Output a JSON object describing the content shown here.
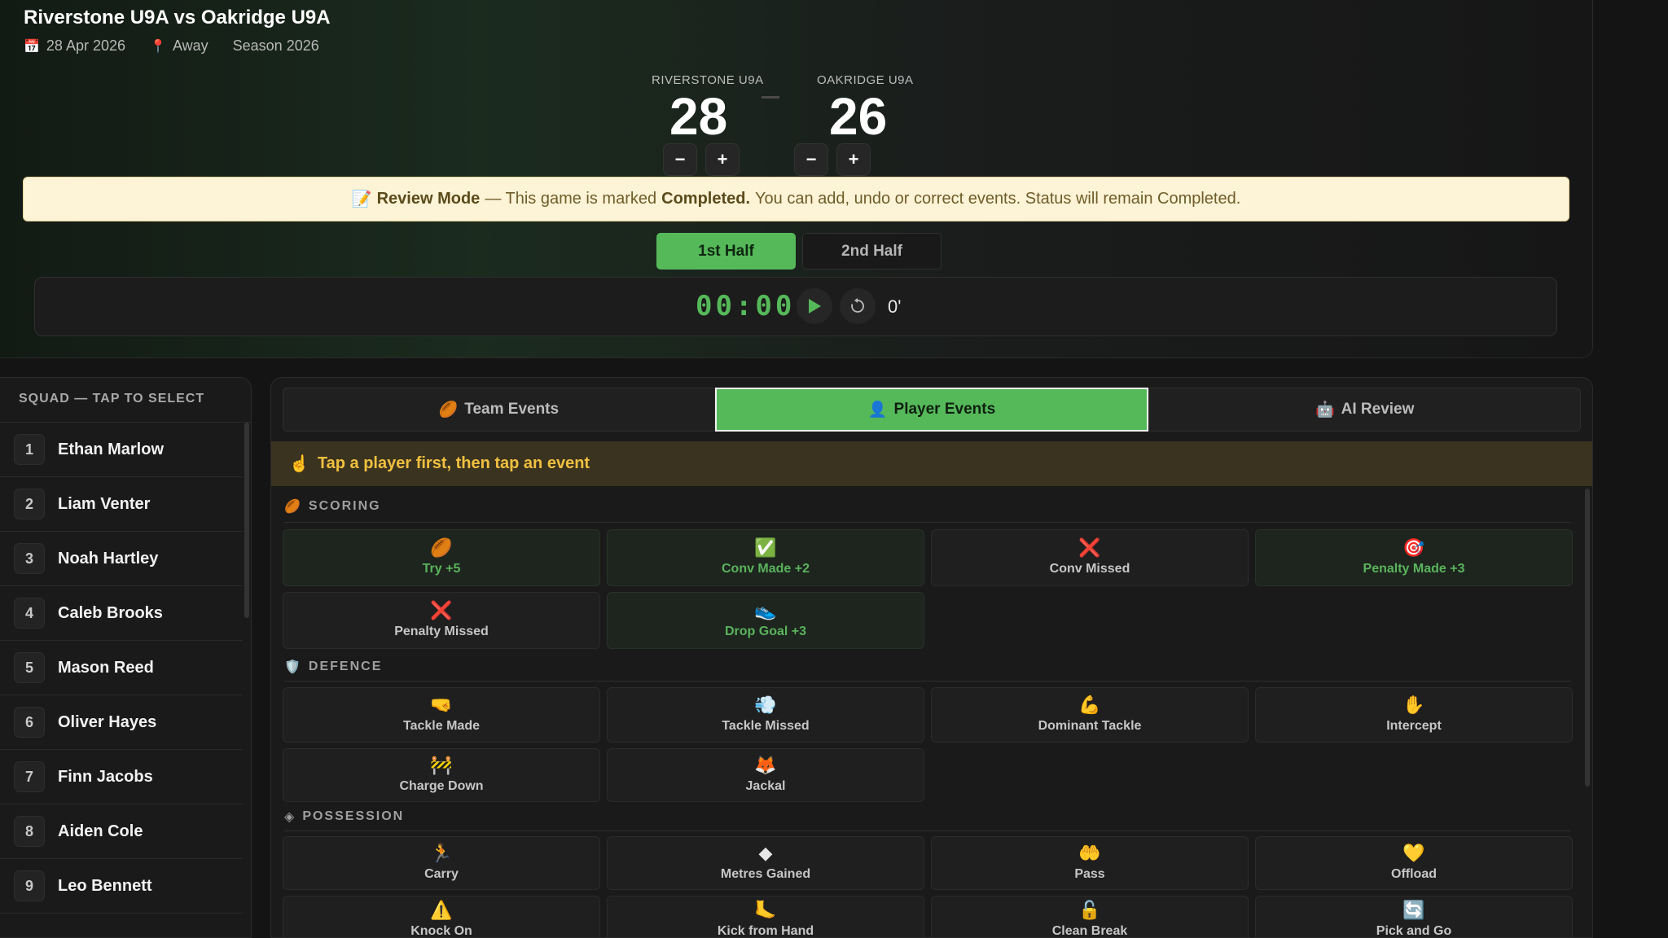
{
  "match": {
    "title": "Riverstone U9A vs Oakridge U9A",
    "date": "28 Apr 2026",
    "venue": "Away",
    "season": "Season 2026",
    "home_team": "RIVERSTONE U9A",
    "away_team": "OAKRIDGE U9A",
    "home_score": "28",
    "away_score": "26",
    "minus_label": "−",
    "plus_label": "+"
  },
  "review": {
    "icon": "📝",
    "mode_label": "Review Mode",
    "text_before": "— This game is marked",
    "status_word": "Completed.",
    "text_after": "You can add, undo or correct events. Status will remain Completed."
  },
  "halves": [
    "1st Half",
    "2nd Half"
  ],
  "timer": {
    "display": "00:00",
    "minute": "0'"
  },
  "squad": {
    "heading": "SQUAD — TAP TO SELECT",
    "players": [
      {
        "num": "1",
        "name": "Ethan Marlow"
      },
      {
        "num": "2",
        "name": "Liam Venter"
      },
      {
        "num": "3",
        "name": "Noah Hartley"
      },
      {
        "num": "4",
        "name": "Caleb Brooks"
      },
      {
        "num": "5",
        "name": "Mason Reed"
      },
      {
        "num": "6",
        "name": "Oliver Hayes"
      },
      {
        "num": "7",
        "name": "Finn Jacobs"
      },
      {
        "num": "8",
        "name": "Aiden Cole"
      },
      {
        "num": "9",
        "name": "Leo Bennett"
      }
    ]
  },
  "tabs": [
    {
      "icon": "🏉",
      "label": "Team Events"
    },
    {
      "icon": "👤",
      "label": "Player Events"
    },
    {
      "icon": "🤖",
      "label": "AI Review"
    }
  ],
  "hint": {
    "icon": "☝️",
    "text": "Tap a player first, then tap an event"
  },
  "sections": {
    "scoring": {
      "icon": "🏉",
      "label": "SCORING"
    },
    "defence": {
      "icon": "🛡️",
      "label": "DEFENCE"
    },
    "possession": {
      "icon": "◈",
      "label": "POSSESSION"
    }
  },
  "scoring_events": [
    {
      "icon": "🏉",
      "label": "Try +5"
    },
    {
      "icon": "✅",
      "label": "Conv Made +2"
    },
    {
      "icon": "❌",
      "label": "Conv Missed"
    },
    {
      "icon": "🎯",
      "label": "Penalty Made +3"
    },
    {
      "icon": "❌",
      "label": "Penalty Missed"
    },
    {
      "icon": "👟",
      "label": "Drop Goal +3"
    }
  ],
  "defence_events": [
    {
      "icon": "🤜",
      "label": "Tackle Made"
    },
    {
      "icon": "💨",
      "label": "Tackle Missed"
    },
    {
      "icon": "💪",
      "label": "Dominant Tackle"
    },
    {
      "icon": "✋",
      "label": "Intercept"
    },
    {
      "icon": "🚧",
      "label": "Charge Down"
    },
    {
      "icon": "🦊",
      "label": "Jackal"
    }
  ],
  "possession_events": [
    {
      "icon": "🏃",
      "label": "Carry"
    },
    {
      "icon": "◆",
      "label": "Metres Gained"
    },
    {
      "icon": "🤲",
      "label": "Pass"
    },
    {
      "icon": "💛",
      "label": "Offload"
    },
    {
      "icon": "⚠️",
      "label": "Knock On"
    },
    {
      "icon": "🦶",
      "label": "Kick from Hand"
    },
    {
      "icon": "🔓",
      "label": "Clean Break"
    },
    {
      "icon": "🔄",
      "label": "Pick and Go"
    }
  ],
  "colors": {
    "accent_green": "#55b95a",
    "banner_bg": "#fdf3d6",
    "hint_text": "#f1c040",
    "background": "#141414"
  }
}
